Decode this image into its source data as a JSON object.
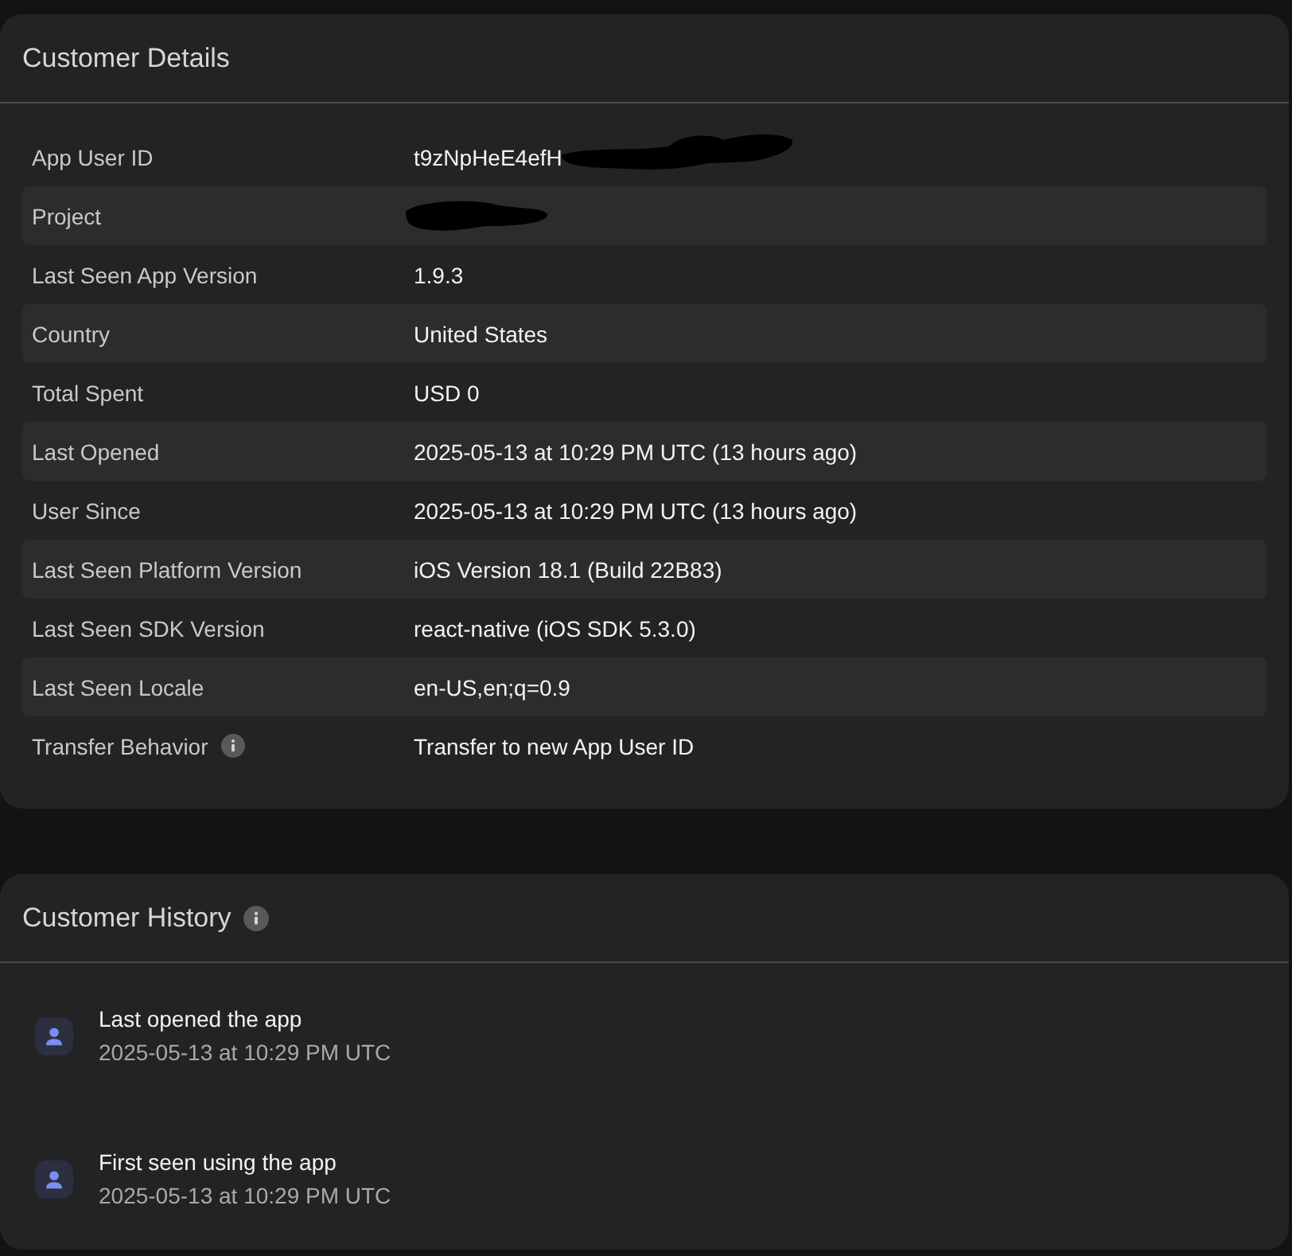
{
  "details": {
    "title": "Customer Details",
    "rows": [
      {
        "label": "App User ID",
        "value": "t9zNpHeE4efH",
        "redacted": true,
        "info": false
      },
      {
        "label": "Project",
        "redacted": true,
        "info": false
      },
      {
        "label": "Last Seen App Version",
        "value": "1.9.3",
        "redacted": false,
        "info": false
      },
      {
        "label": "Country",
        "value": "United States",
        "redacted": false,
        "info": false
      },
      {
        "label": "Total Spent",
        "value": "USD 0",
        "redacted": false,
        "info": false
      },
      {
        "label": "Last Opened",
        "value": "2025-05-13 at 10:29 PM UTC (13 hours ago)",
        "redacted": false,
        "info": false
      },
      {
        "label": "User Since",
        "value": "2025-05-13 at 10:29 PM UTC (13 hours ago)",
        "redacted": false,
        "info": false
      },
      {
        "label": "Last Seen Platform Version",
        "value": "iOS Version 18.1 (Build 22B83)",
        "redacted": false,
        "info": false
      },
      {
        "label": "Last Seen SDK Version",
        "value": "react-native (iOS SDK 5.3.0)",
        "redacted": false,
        "info": false
      },
      {
        "label": "Last Seen Locale",
        "value": "en-US,en;q=0.9",
        "redacted": false,
        "info": false
      },
      {
        "label": "Transfer Behavior",
        "value": "Transfer to new App User ID",
        "redacted": false,
        "info": true
      }
    ]
  },
  "history": {
    "title": "Customer History",
    "info": true,
    "events": [
      {
        "title": "Last opened the app",
        "time": "2025-05-13 at 10:29 PM UTC"
      },
      {
        "title": "First seen using the app",
        "time": "2025-05-13 at 10:29 PM UTC"
      }
    ]
  }
}
